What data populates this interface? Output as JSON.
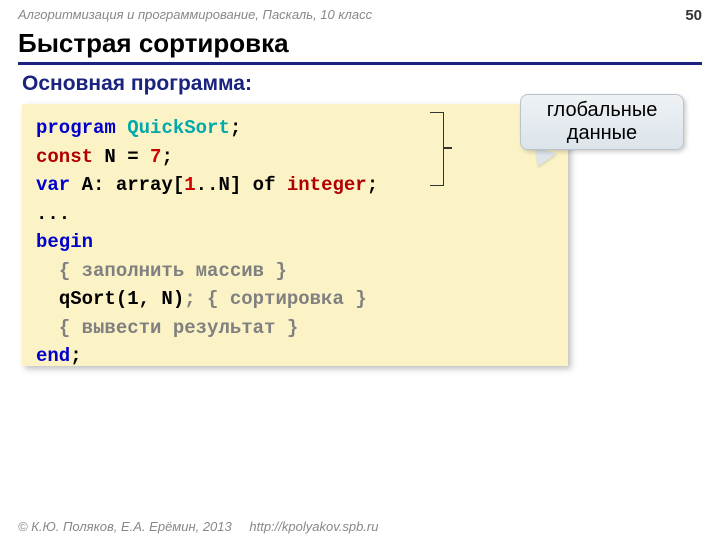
{
  "header": {
    "course_line": "Алгоритмизация и программирование, Паскаль, 10 класс",
    "page_number": "50"
  },
  "title": "Быстрая сортировка",
  "subtitle": "Основная программа:",
  "callout": "глобальные данные",
  "code": {
    "line1": {
      "kw": "program",
      "name": "QuickSort",
      "semi": ";"
    },
    "line2": {
      "kw": "const",
      "var": "N",
      "eq": " = ",
      "val": "7",
      "semi": ";"
    },
    "line3": {
      "kw": "var",
      "decl": " A: array[",
      "one": "1",
      "rest": "..N] of ",
      "type": "integer",
      "semi": ";"
    },
    "line4": "...",
    "line5": "begin",
    "line6_cmt": "{ заполнить массив }",
    "line7_call": "qSort(1, N)",
    "line7_semi": ";",
    "line7_cmt": " { сортировка }",
    "line8_cmt": "{ вывести результат }",
    "line9": "end",
    "line9_semi": ";"
  },
  "footer": {
    "copyright": "© К.Ю. Поляков, Е.А. Ерёмин, 2013",
    "url": "http://kpolyakov.spb.ru"
  }
}
